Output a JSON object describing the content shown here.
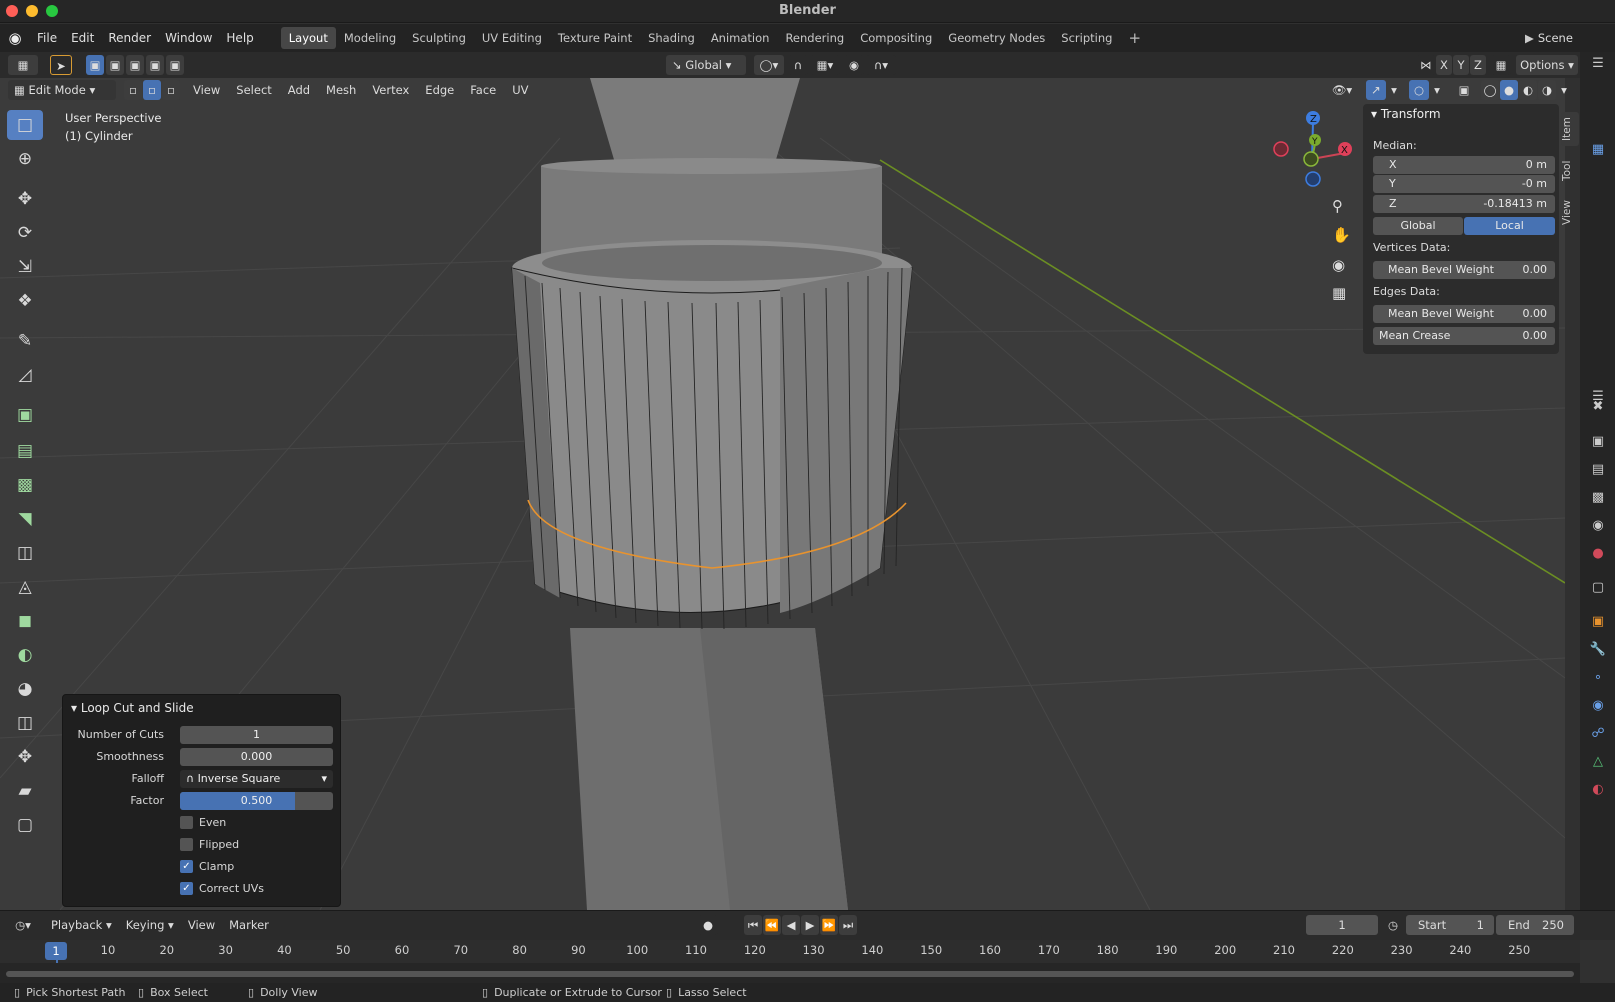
{
  "window": {
    "title": "Blender"
  },
  "menu": {
    "logo_icon": "blender-logo-icon",
    "items": [
      "File",
      "Edit",
      "Render",
      "Window",
      "Help"
    ]
  },
  "workspaces": [
    "Layout",
    "Modeling",
    "Sculpting",
    "UV Editing",
    "Texture Paint",
    "Shading",
    "Animation",
    "Rendering",
    "Compositing",
    "Geometry Nodes",
    "Scripting"
  ],
  "active_workspace": "Layout",
  "scene": {
    "label": "Scene"
  },
  "header": {
    "orientation": "Global",
    "axes": [
      "X",
      "Y",
      "Z"
    ],
    "options": "Options",
    "mode": "Edit Mode",
    "menus": [
      "View",
      "Select",
      "Add",
      "Mesh",
      "Vertex",
      "Edge",
      "Face",
      "UV"
    ]
  },
  "viewport": {
    "perspective": "User Perspective",
    "object": "(1) Cylinder"
  },
  "gizmo": {
    "x": "X",
    "y": "Y",
    "z": "Z"
  },
  "transform_panel": {
    "title": "Transform",
    "median_label": "Median:",
    "x_label": "X",
    "x_value": "0 m",
    "y_label": "Y",
    "y_value": "-0 m",
    "z_label": "Z",
    "z_value": "-0.18413 m",
    "global": "Global",
    "local": "Local",
    "vertices_data": "Vertices Data:",
    "v_bevel_label": "Mean Bevel Weight",
    "v_bevel_value": "0.00",
    "edges_data": "Edges Data:",
    "e_bevel_label": "Mean Bevel Weight",
    "e_bevel_value": "0.00",
    "crease_label": "Mean Crease",
    "crease_value": "0.00"
  },
  "side_tabs": [
    "Item",
    "Tool",
    "View"
  ],
  "operator_panel": {
    "title": "Loop Cut and Slide",
    "cuts_label": "Number of Cuts",
    "cuts_value": "1",
    "smooth_label": "Smoothness",
    "smooth_value": "0.000",
    "falloff_label": "Falloff",
    "falloff_value": "Inverse Square",
    "factor_label": "Factor",
    "factor_value": "0.500",
    "factor_fraction": 0.75,
    "even": "Even",
    "flipped": "Flipped",
    "clamp": "Clamp",
    "correct_uvs": "Correct UVs"
  },
  "timeline": {
    "menus": [
      "Playback",
      "Keying",
      "View",
      "Marker"
    ],
    "current_frame": "1",
    "start_label": "Start",
    "start_value": "1",
    "end_label": "End",
    "end_value": "250",
    "ticks": [
      "10",
      "20",
      "30",
      "40",
      "50",
      "60",
      "70",
      "80",
      "90",
      "100",
      "110",
      "120",
      "130",
      "140",
      "150",
      "160",
      "170",
      "180",
      "190",
      "200",
      "210",
      "220",
      "230",
      "240",
      "250"
    ],
    "playhead": "1"
  },
  "status": {
    "left": "Pick Shortest Path",
    "box": "Box Select",
    "dolly": "Dolly View",
    "duplicate": "Duplicate or Extrude to Cursor",
    "lasso": "Lasso Select"
  }
}
